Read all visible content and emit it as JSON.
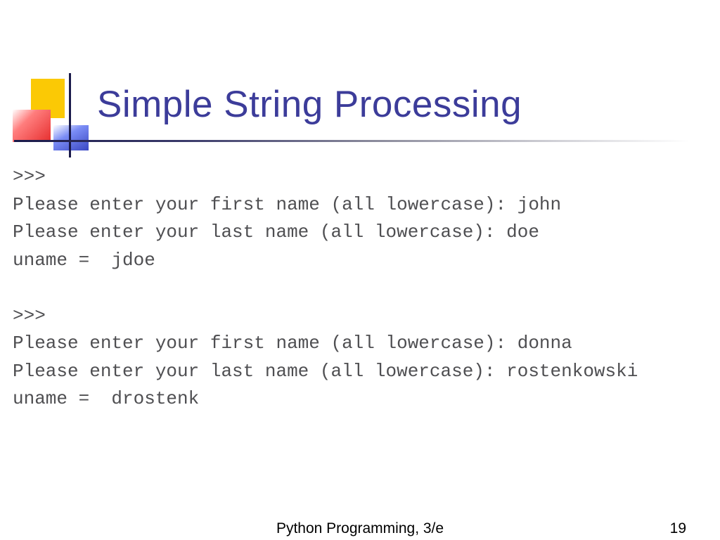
{
  "title": "Simple String Processing",
  "code": ">>>\nPlease enter your first name (all lowercase): john\nPlease enter your last name (all lowercase): doe\nuname =  jdoe\n\n>>>\nPlease enter your first name (all lowercase): donna\nPlease enter your last name (all lowercase): rostenkowski\nuname =  drostenk",
  "footer": {
    "center": "Python Programming, 3/e",
    "page": "19"
  }
}
